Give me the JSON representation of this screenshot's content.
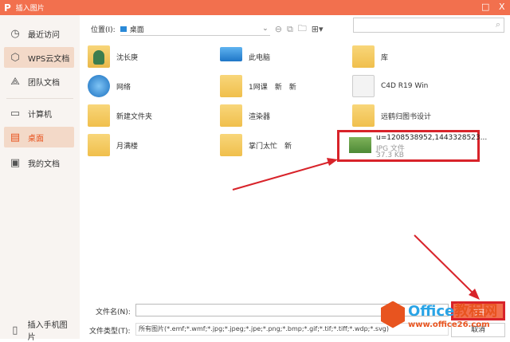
{
  "title": "插入图片",
  "window_controls": {
    "maximize": "□",
    "close": "X"
  },
  "sidebar": {
    "items": [
      {
        "label": "最近访问",
        "icon": "clock-icon",
        "glyph": "◷"
      },
      {
        "label": "WPS云文档",
        "icon": "cloud-icon",
        "glyph": "⬡"
      },
      {
        "label": "团队文档",
        "icon": "team-icon",
        "glyph": "⟁"
      },
      {
        "label": "计算机",
        "icon": "computer-icon",
        "glyph": "▭"
      },
      {
        "label": "桌面",
        "icon": "desktop-icon",
        "glyph": "▤"
      },
      {
        "label": "我的文档",
        "icon": "documents-icon",
        "glyph": "▣"
      }
    ],
    "phone_label": "插入手机图片"
  },
  "toolbar": {
    "location_label": "位置(I):",
    "location_value": "桌面"
  },
  "files": [
    {
      "name": "沈长庚",
      "type": "user"
    },
    {
      "name": "此电脑",
      "type": "pc"
    },
    {
      "name": "库",
      "type": "folder"
    },
    {
      "name": "网络",
      "type": "net"
    },
    {
      "name": "1网课　新　新",
      "type": "folder"
    },
    {
      "name": "C4D R19 Win",
      "type": "cd"
    },
    {
      "name": "新建文件夹",
      "type": "folder"
    },
    {
      "name": "渲染器",
      "type": "folder"
    },
    {
      "name": "远鹤归图书设计",
      "type": "folder"
    },
    {
      "name": "月满楼",
      "type": "folder"
    },
    {
      "name": "掌门太忙　新",
      "type": "folder"
    }
  ],
  "selected_file": {
    "name": "u=1208538952,1443328523...",
    "type": "JPG 文件",
    "size": "37.3 KB"
  },
  "bottom": {
    "filename_label": "文件名(N):",
    "filename_value": "",
    "filetype_label": "文件类型(T):",
    "filetype_value": "所有图片(*.emf;*.wmf;*.jpg;*.jpeg;*.jpe;*.png;*.bmp;*.gif;*.tif;*.tiff;*.wdp;*.svg)",
    "open_label": "打开",
    "cancel_label": "取消"
  },
  "watermark": {
    "brand": "Office",
    "brand2": "教程网",
    "url": "www.office26.com"
  },
  "colors": {
    "accent": "#f2704e",
    "highlight": "#d8232a"
  }
}
